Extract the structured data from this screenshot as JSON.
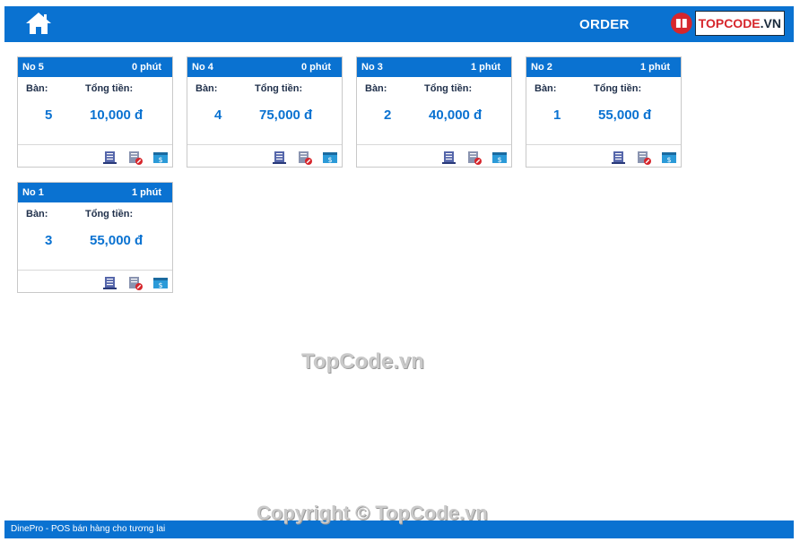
{
  "header": {
    "title": "ORDER",
    "brand": {
      "name_a": "TOPCODE",
      "name_b": ".VN"
    }
  },
  "labels": {
    "table": "Bàn:",
    "total": "Tổng tiền:"
  },
  "orders": [
    {
      "no": "No 5",
      "time": "0 phút",
      "table": "5",
      "total": "10,000 đ"
    },
    {
      "no": "No 4",
      "time": "0 phút",
      "table": "4",
      "total": "75,000 đ"
    },
    {
      "no": "No 3",
      "time": "1 phút",
      "table": "2",
      "total": "40,000 đ"
    },
    {
      "no": "No 2",
      "time": "1 phút",
      "table": "1",
      "total": "55,000 đ"
    },
    {
      "no": "No 1",
      "time": "1 phút",
      "table": "3",
      "total": "55,000 đ"
    }
  ],
  "icons": {
    "home": "home-icon",
    "detail": "receipt-icon",
    "cancel": "cancel-order-icon",
    "pay": "payment-icon"
  },
  "watermark": "TopCode.vn",
  "copyright": "Copyright © TopCode.vn",
  "footer": {
    "text": "DinePro - POS bán hàng cho tương lai"
  },
  "colors": {
    "primary": "#0a72d1",
    "accent_red": "#d6262c"
  }
}
